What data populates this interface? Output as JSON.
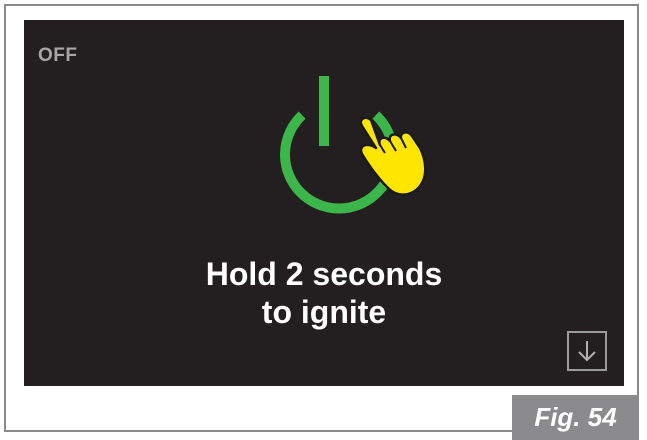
{
  "screen": {
    "status": "OFF",
    "instruction_line1": "Hold 2 seconds",
    "instruction_line2": "to ignite"
  },
  "icons": {
    "power": "power-icon",
    "hand": "pointing-hand-icon",
    "down_arrow": "down-arrow-icon"
  },
  "colors": {
    "screen_background": "#231f20",
    "power_green": "#3cb54a",
    "hand_yellow": "#ffe600",
    "status_gray": "#a7a5a6",
    "caption_background": "#8b8b8d"
  },
  "caption": "Fig. 54"
}
